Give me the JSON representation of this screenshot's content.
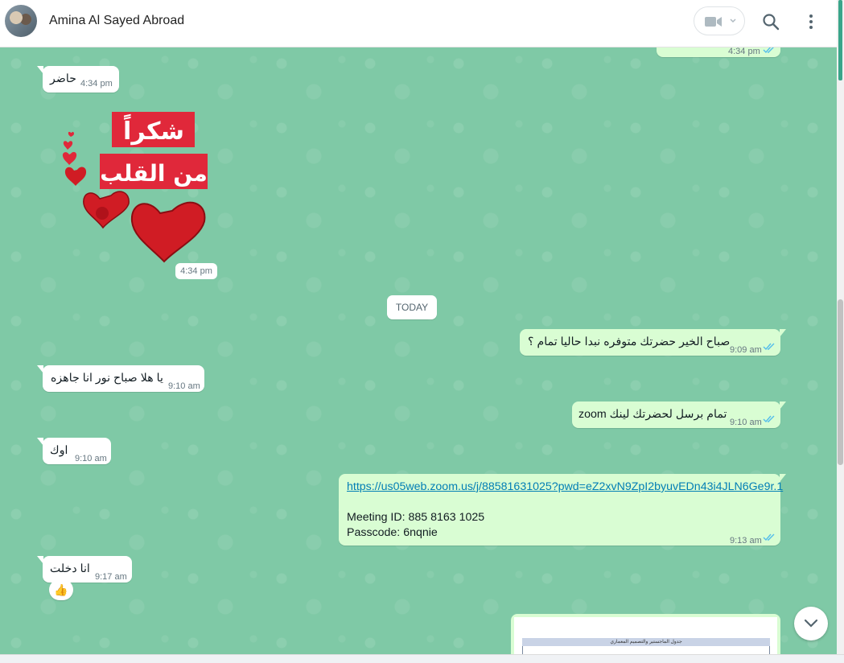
{
  "header": {
    "contact_name": "Amina Al Sayed Abroad",
    "icons": [
      "avatar",
      "video-call-icon",
      "chevron-down-icon",
      "search-icon",
      "menu-icon"
    ]
  },
  "colors": {
    "chat_background": "#7fc9a6",
    "incoming_bubble": "#ffffff",
    "outgoing_bubble": "#d9fdd3",
    "read_ticks": "#53bdeb",
    "link": "#027eb5"
  },
  "messages": {
    "top_out_partial": {
      "time": "4:34 pm"
    },
    "m1": {
      "text": "حاضر",
      "time": "4:34 pm"
    },
    "sticker": {
      "line1": "شكراً",
      "line2": "من القلب",
      "time": "4:34 pm"
    },
    "day_divider": "TODAY",
    "m2": {
      "text": "صباح الخير حضرتك متوفره نبدا حاليا تمام ؟",
      "time": "9:09 am"
    },
    "m3": {
      "text": "يا هلا صباح نور انا جاهزه",
      "time": "9:10 am"
    },
    "m4": {
      "text": "تمام برسل لحضرتك لينك zoom",
      "time": "9:10 am"
    },
    "m5": {
      "text": "اوك",
      "time": "9:10 am"
    },
    "m6": {
      "link": "https://us05web.zoom.us/j/88581631025?pwd=eZ2xvN9ZpI2byuvEDn43i4JLN6Ge9r.1",
      "meeting_id": "Meeting ID: 885 8163 1025",
      "passcode": "Passcode: 6nqnie",
      "time": "9:13 am"
    },
    "m7": {
      "text": "انا دخلت",
      "time": "9:17 am",
      "reaction": "👍"
    },
    "doc_preview": {
      "title": "جدول الماجستير والتصميم المعماري"
    }
  }
}
